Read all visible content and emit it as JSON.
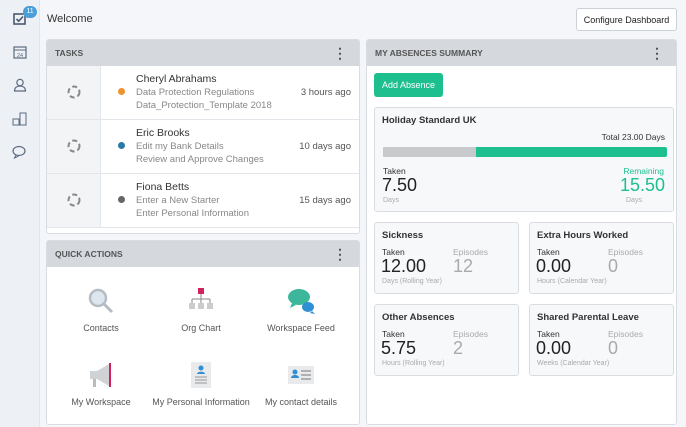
{
  "sidebar": {
    "badge_count": "11",
    "items": [
      "tasks-icon",
      "calendar-icon",
      "user-icon",
      "org-icon",
      "chat-icon"
    ],
    "calendar_day": "24"
  },
  "header": {
    "welcome": "Welcome",
    "configure_label": "Configure Dashboard"
  },
  "tasks": {
    "title": "TASKS",
    "items": [
      {
        "name": "Cheryl Abrahams",
        "line1": "Data Protection Regulations",
        "line2": "Data_Protection_Template 2018",
        "time": "3 hours ago",
        "dot_color": "#f0922e"
      },
      {
        "name": "Eric Brooks",
        "line1": "Edit my Bank Details",
        "line2": "Review and Approve Changes",
        "time": "10 days ago",
        "dot_color": "#2a7aa8"
      },
      {
        "name": "Fiona Betts",
        "line1": "Enter a New Starter",
        "line2": "Enter Personal Information",
        "time": "15 days ago",
        "dot_color": "#666666"
      }
    ]
  },
  "quick_actions": {
    "title": "QUICK ACTIONS",
    "items": [
      {
        "label": "Contacts",
        "icon": "search-icon"
      },
      {
        "label": "Org Chart",
        "icon": "org-chart-icon"
      },
      {
        "label": "Workspace Feed",
        "icon": "chat-bubbles-icon"
      },
      {
        "label": "My Workspace",
        "icon": "megaphone-icon"
      },
      {
        "label": "My Personal Information",
        "icon": "document-person-icon"
      },
      {
        "label": "My contact details",
        "icon": "contact-card-icon"
      }
    ]
  },
  "absences": {
    "title": "MY ABSENCES SUMMARY",
    "add_label": "Add Absence",
    "holiday": {
      "title": "Holiday Standard UK",
      "total": "Total 23.00 Days",
      "taken_label": "Taken",
      "taken": "7.50",
      "taken_unit": "Days",
      "remaining_label": "Remaining",
      "remaining": "15.50",
      "remaining_unit": "Days",
      "taken_fraction": 0.326
    },
    "cards": [
      {
        "title": "Sickness",
        "taken_label": "Taken",
        "taken": "12.00",
        "episodes_label": "Episodes",
        "episodes": "12",
        "unit": "Days (Rolling Year)"
      },
      {
        "title": "Extra Hours Worked",
        "taken_label": "Taken",
        "taken": "0.00",
        "episodes_label": "Episodes",
        "episodes": "0",
        "unit": "Hours (Calendar Year)"
      },
      {
        "title": "Other Absences",
        "taken_label": "Taken",
        "taken": "5.75",
        "episodes_label": "Episodes",
        "episodes": "2",
        "unit": "Hours (Rolling Year)"
      },
      {
        "title": "Shared Parental Leave",
        "taken_label": "Taken",
        "taken": "0.00",
        "episodes_label": "Episodes",
        "episodes": "0",
        "unit": "Weeks (Calendar Year)"
      }
    ]
  },
  "colors": {
    "accent": "#1dbf8e",
    "bar_taken": "#c8c9cb",
    "badge": "#4a9fd8"
  }
}
